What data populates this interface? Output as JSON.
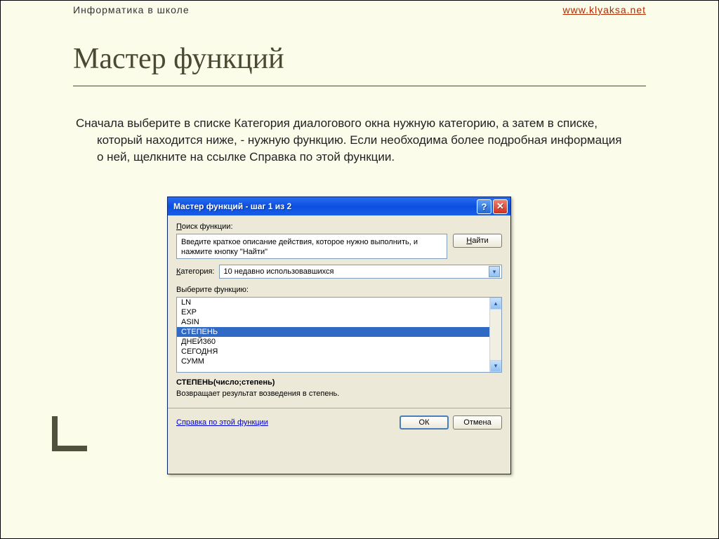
{
  "header": {
    "left": "Информатика в школе",
    "right": "www.klyaksa.net"
  },
  "title": "Мастер функций",
  "description": "Сначала выберите в списке Категория диалогового окна нужную категорию, а затем в списке, который находится ниже, - нужную функцию. Если необходима более подробная информация о ней, щелкните на ссылке Справка по этой функции.",
  "dialog": {
    "title": "Мастер функций - шаг 1 из 2",
    "search_label_pre": "П",
    "search_label_rest": "оиск функции:",
    "search_text": "Введите краткое описание действия, которое нужно выполнить, и нажмите кнопку \"Найти\"",
    "find_btn_pre": "Н",
    "find_btn_rest": "айти",
    "category_label_pre": "К",
    "category_label_rest": "атегория:",
    "category_value": "10 недавно использовавшихся",
    "select_func_label": "Выберите функцию:",
    "functions": [
      "LN",
      "EXP",
      "ASIN",
      "СТЕПЕНЬ",
      "ДНЕЙ360",
      "СЕГОДНЯ",
      "СУММ"
    ],
    "selected_index": 3,
    "signature": "СТЕПЕНЬ(число;степень)",
    "func_description": "Возвращает результат возведения в степень.",
    "help_link": "Справка по этой функции",
    "ok": "ОК",
    "cancel": "Отмена",
    "help_icon": "?",
    "close_icon": "✕",
    "dd_icon": "▾",
    "up_icon": "▴",
    "down_icon": "▾"
  }
}
